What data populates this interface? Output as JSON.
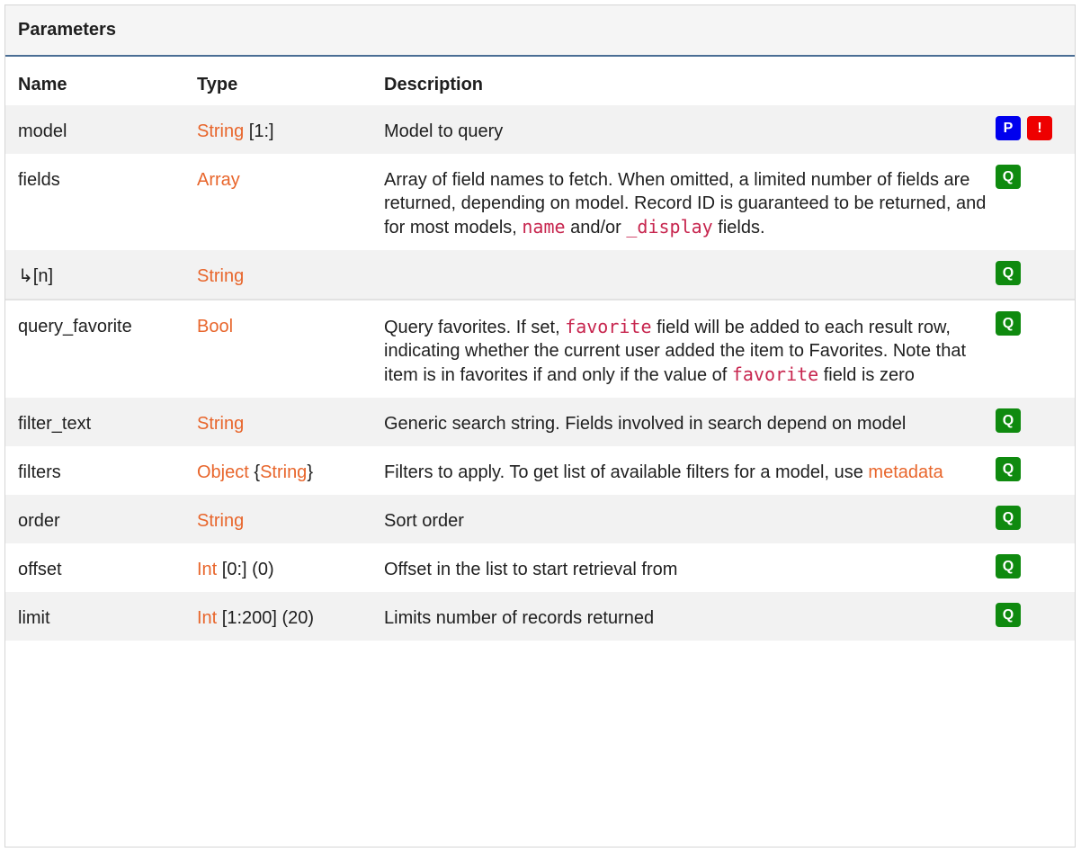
{
  "panel": {
    "title": "Parameters"
  },
  "columns": {
    "name": "Name",
    "type": "Type",
    "description": "Description"
  },
  "rows": [
    {
      "name": "model",
      "type_main": "String",
      "type_extra": " [1:]",
      "desc_parts": [
        "Model to query"
      ],
      "flags": [
        "P",
        "!"
      ]
    },
    {
      "name": "fields",
      "type_main": "Array",
      "type_extra": "",
      "desc_parts": [
        "Array of field names to fetch. When omitted, a limited number of fields are returned, depending on model. Record ID is guaranteed to be returned, and for most models, ",
        "name",
        " and/or ",
        "_display",
        " fields."
      ],
      "flags": [
        "Q"
      ]
    },
    {
      "name": "↳[n]",
      "type_main": "String",
      "type_extra": "",
      "desc_parts": [
        ""
      ],
      "flags": [
        "Q"
      ]
    },
    {
      "name": "query_favorite",
      "type_main": "Bool",
      "type_extra": "",
      "desc_parts": [
        "Query favorites. If set, ",
        "favorite",
        " field will be added to each result row, indicating whether the current user added the item to Favorites. Note that item is in favorites if and only if the value of ",
        "favorite",
        " field is zero"
      ],
      "flags": [
        "Q"
      ]
    },
    {
      "name": "filter_text",
      "type_main": "String",
      "type_extra": "",
      "desc_parts": [
        "Generic search string. Fields involved in search depend on model"
      ],
      "flags": [
        "Q"
      ]
    },
    {
      "name": "filters",
      "type_main": "Object",
      "type_extra_a": " {",
      "type_main2": "String",
      "type_extra_b": "}",
      "desc_parts": [
        "Filters to apply. To get list of available filters for a model, use ",
        "metadata"
      ],
      "flags": [
        "Q"
      ]
    },
    {
      "name": "order",
      "type_main": "String",
      "type_extra": "",
      "desc_parts": [
        "Sort order"
      ],
      "flags": [
        "Q"
      ]
    },
    {
      "name": "offset",
      "type_main": "Int",
      "type_extra": " [0:] (0)",
      "desc_parts": [
        "Offset in the list to start retrieval from"
      ],
      "flags": [
        "Q"
      ]
    },
    {
      "name": "limit",
      "type_main": "Int",
      "type_extra": " [1:200] (20)",
      "desc_parts": [
        "Limits number of records returned"
      ],
      "flags": [
        "Q"
      ]
    }
  ],
  "colors": {
    "type_link": "#e8662c",
    "code": "#c7254e",
    "badge_P": "#0000ee",
    "badge_required": "#ee0000",
    "badge_Q": "#0f8a0f",
    "header_rule": "#4a6d94"
  }
}
